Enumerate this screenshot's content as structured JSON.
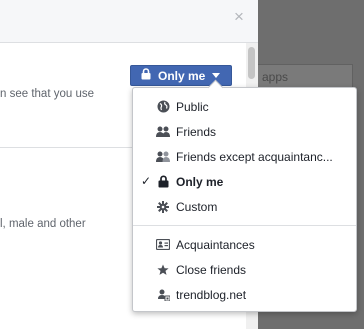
{
  "backdrop": {
    "search_field_text": "apps"
  },
  "dialog": {
    "close_glyph": "×",
    "text_line_1": "n see that you use",
    "text_line_2": "l, male and other"
  },
  "privacy_button": {
    "label": "Only me"
  },
  "dropdown": {
    "items": [
      {
        "label": "Public",
        "icon": "globe-icon",
        "selected": false
      },
      {
        "label": "Friends",
        "icon": "friends-icon",
        "selected": false
      },
      {
        "label": "Friends except acquaintanc...",
        "icon": "friends-except-icon",
        "selected": false
      },
      {
        "label": "Only me",
        "icon": "lock-icon",
        "selected": true
      },
      {
        "label": "Custom",
        "icon": "gear-icon",
        "selected": false
      }
    ],
    "lists": [
      {
        "label": "Acquaintances",
        "icon": "contact-card-icon"
      },
      {
        "label": "Close friends",
        "icon": "star-icon"
      },
      {
        "label": "trendblog.net",
        "icon": "network-icon"
      }
    ],
    "check_glyph": "✓"
  },
  "colors": {
    "accent": "#4267b2",
    "text": "#1d2129",
    "muted_text": "#60656d",
    "overlay": "#6e6e6e"
  }
}
